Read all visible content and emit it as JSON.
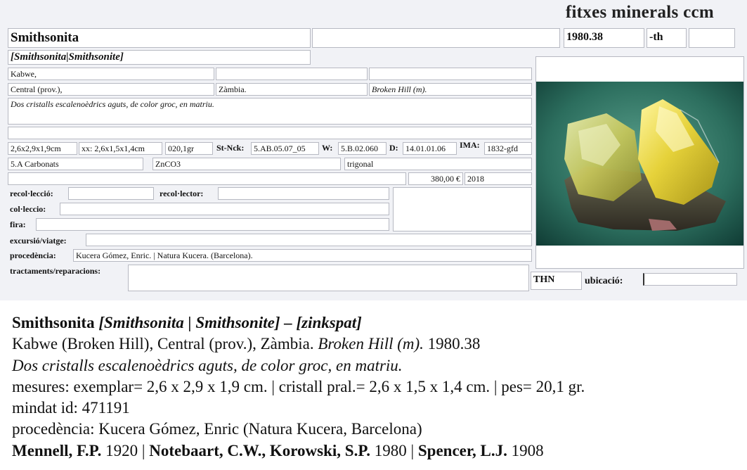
{
  "site_title": "fitxes minerals ccm",
  "card": {
    "name": "Smithsonita",
    "blank1": "",
    "catalog": "1980.38",
    "suffix": "-th",
    "blank2": "",
    "synonyms": "[Smithsonita|Smithsonite]",
    "locality_1": "Kabwe,",
    "locality_2": "",
    "locality_3": "",
    "region": "Central (prov.),",
    "country": "Zàmbia.",
    "mine": "Broken Hill (m).",
    "description": "Dos cristalls escalenoèdrics aguts, de color groc, en matriu.",
    "blank_line": "",
    "size_specimen": "2,6x2,9x1,9cm",
    "size_crystal": "xx: 2,6x1,5x1,4cm",
    "weight": "020,1gr",
    "strunz_label": "St-Nck:",
    "strunz": "5.AB.05.07_05",
    "w_label": "W:",
    "w_value": "5.B.02.060",
    "d_label": "D:",
    "d_value": "14.01.01.06",
    "ima_label": "IMA:",
    "ima": "1832-gfd",
    "class": "5.A Carbonats",
    "formula": "ZnCO3",
    "system": "trigonal",
    "blank_price_left": "",
    "price": "380,00 €",
    "year": "2018",
    "recoleccio_label": "recol·lecció:",
    "recoleccio": "",
    "recolector_label": "recol·lector:",
    "recolector": "",
    "colleccio_label": "col·leccio:",
    "colleccio": "",
    "fira_label": "fira:",
    "fira": "",
    "excursio_label": "excursió/viatge:",
    "excursio": "",
    "procedencia_label": "procedència:",
    "procedencia": "Kucera Gómez, Enric. | Natura Kucera. (Barcelona).",
    "tractaments_label": "tractaments/reparacions:",
    "tractaments": "",
    "thn": "THN",
    "ubicacio_label": "ubicació:",
    "ubicacio": ""
  },
  "summary": {
    "name": "Smithsonita",
    "synonyms": "[Smithsonita | Smithsonite] – [zinkspat]",
    "locality": "Kabwe (Broken Hill), Central (prov.), Zàmbia. ",
    "mine": "Broken Hill (m).",
    "catalog": " 1980.38",
    "description": "Dos cristalls escalenoèdrics aguts, de color groc, en matriu.",
    "measures": "mesures: exemplar= 2,6 x 2,9 x 1,9 cm. | cristall pral.= 2,6 x 1,5 x 1,4 cm. | pes= 20,1 gr.",
    "mindat": "mindat id: 471191",
    "procedencia": "procedència: Kucera Gómez, Enric (Natura Kucera, Barcelona)",
    "ref1_author": "Mennell, F.P.",
    "ref1_year": " 1920",
    "sep1": " | ",
    "ref2_author": "Notebaart, C.W., Korowski, S.P.",
    "ref2_year": " 1980",
    "sep2": " | ",
    "ref3_author": "Spencer, L.J.",
    "ref3_year": " 1908"
  },
  "colors": {
    "card_bg": "#f1f2f6",
    "border": "#b7b9c2",
    "photo_bg": "#1d5c4e"
  }
}
